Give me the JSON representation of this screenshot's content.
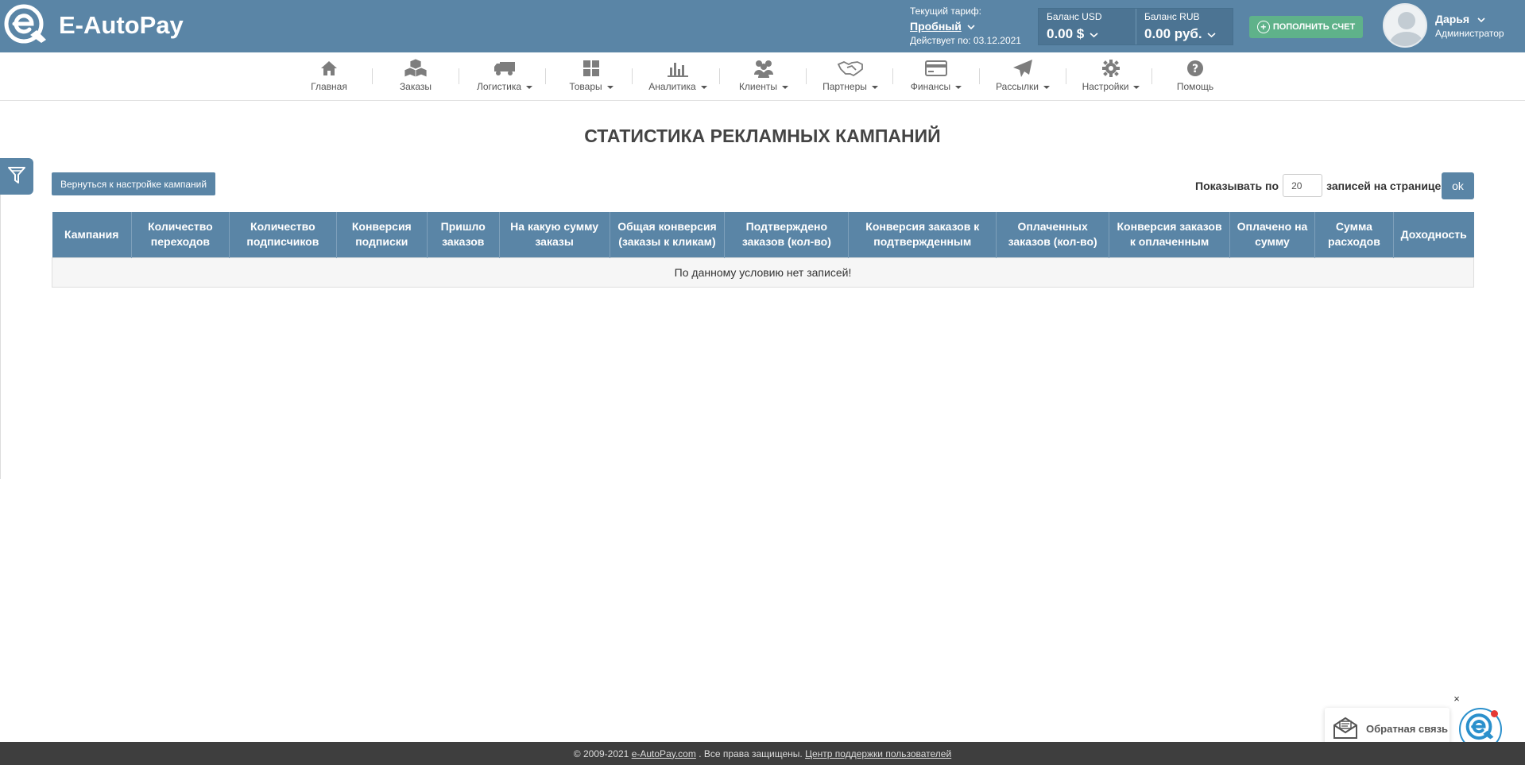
{
  "header": {
    "logo_text": "E-AutoPay",
    "tariff_label": "Текущий тариф:",
    "tariff_plan": "Пробный",
    "tariff_valid": "Действует по: 03.12.2021",
    "balance_usd_label": "Баланс USD",
    "balance_usd_value": "0.00 $",
    "balance_rub_label": "Баланс RUB",
    "balance_rub_value": "0.00 руб.",
    "topup_label": "ПОПОЛНИТЬ СЧЕТ",
    "user_name": "Дарья",
    "user_role": "Администратор"
  },
  "nav": [
    {
      "label": "Главная",
      "icon": "home-icon"
    },
    {
      "label": "Заказы",
      "icon": "boxes-icon"
    },
    {
      "label": "Логистика",
      "icon": "truck-icon"
    },
    {
      "label": "Товары",
      "icon": "products-icon"
    },
    {
      "label": "Аналитика",
      "icon": "chart-icon"
    },
    {
      "label": "Клиенты",
      "icon": "users-icon"
    },
    {
      "label": "Партнеры",
      "icon": "handshake-icon"
    },
    {
      "label": "Финансы",
      "icon": "credit-card-icon"
    },
    {
      "label": "Рассылки",
      "icon": "paper-plane-icon"
    },
    {
      "label": "Настройки",
      "icon": "gear-icon"
    },
    {
      "label": "Помощь",
      "icon": "question-icon"
    }
  ],
  "page": {
    "title": "СТАТИСТИКА РЕКЛАМНЫХ КАМПАНИЙ",
    "back_button": "Вернуться к настройке кампаний",
    "per_page_label": "Показывать по",
    "per_page_value": "20",
    "per_page_suffix": "записей на странице",
    "ok_button": "ok"
  },
  "table": {
    "columns": [
      "Кампания",
      "Количество переходов",
      "Количество подписчиков",
      "Конверсия подписки",
      "Пришло заказов",
      "На какую сумму заказы",
      "Общая конверсия (заказы к кликам)",
      "Подтверждено заказов (кол-во)",
      "Конверсия заказов к подтвержденным",
      "Оплаченных заказов (кол-во)",
      "Конверсия заказов к оплаченным",
      "Оплачено на сумму",
      "Сумма расходов",
      "Доходность"
    ],
    "empty_message": "По данному условию нет записей!"
  },
  "feedback": {
    "label": "Обратная связь",
    "close": "×"
  },
  "footer": {
    "copyright": "© 2009-2021 ",
    "site_link": "e-AutoPay.com",
    "rights": " . Все права защищены. ",
    "support_link": "Центр поддержки пользователей"
  },
  "colors": {
    "brand": "#5a85a6",
    "topup": "#5fb28a",
    "footer": "#3e3e3e"
  }
}
